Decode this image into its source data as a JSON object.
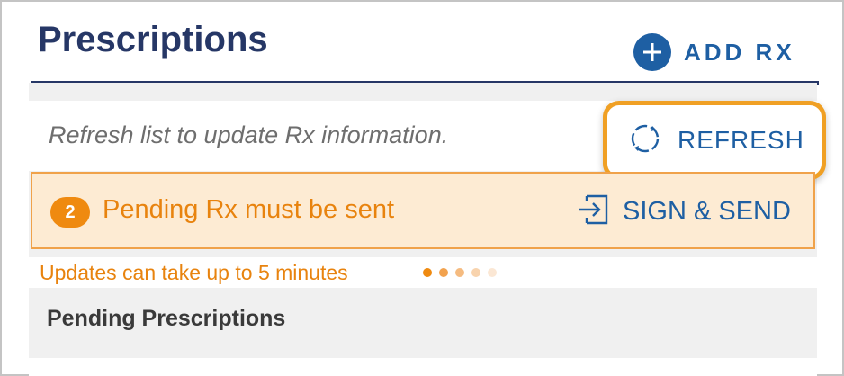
{
  "header": {
    "title": "Prescriptions",
    "add_rx_label": "ADD RX"
  },
  "refresh": {
    "hint": "Refresh list to update Rx information.",
    "button_label": "REFRESH"
  },
  "pending": {
    "count": "2",
    "message": "Pending Rx must be sent",
    "sign_send_label": "SIGN & SEND"
  },
  "updates": {
    "message": "Updates can take up to 5 minutes"
  },
  "section": {
    "title": "Pending Prescriptions"
  },
  "colors": {
    "navy": "#263766",
    "link_blue": "#1e5fa3",
    "orange": "#e8830e",
    "highlight_orange": "#f0a024",
    "banner_bg": "#fdebd3"
  },
  "icons": {
    "add": "plus-circle-icon",
    "refresh": "refresh-icon",
    "sign_send": "sign-in-arrow-icon",
    "loading": "loading-dots-icon"
  }
}
